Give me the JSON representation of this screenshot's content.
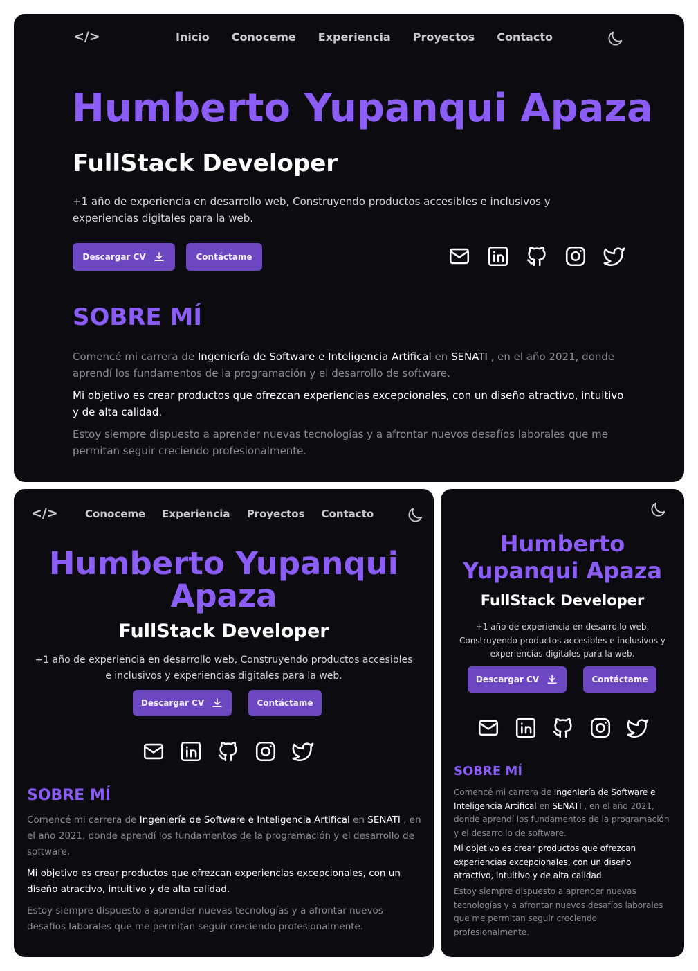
{
  "nav": {
    "logo": "</>",
    "links": [
      "Inicio",
      "Conoceme",
      "Experiencia",
      "Proyectos",
      "Contacto"
    ]
  },
  "hero": {
    "name": "Humberto Yupanqui Apaza",
    "name_line1": "Humberto Yupanqui",
    "name_line2": "Apaza",
    "name_m_line1": "Humberto",
    "name_m_line2": "Yupanqui Apaza",
    "role": "FullStack Developer",
    "intro": "+1 año de experiencia en desarrollo web, Construyendo productos accesibles e inclusivos y experiencias digitales para la web.",
    "download_label": "Descargar CV",
    "contact_label": "Contáctame"
  },
  "socials": [
    "mail-icon",
    "linkedin-icon",
    "github-icon",
    "instagram-icon",
    "twitter-icon"
  ],
  "about": {
    "title": "SOBRE MÍ",
    "p1_a": "Comencé mi carrera de ",
    "p1_b": "Ingeniería de Software e Inteligencia Artifical",
    "p1_c": " en ",
    "p1_d": "SENATI",
    "p1_e": " , en el año 2021, donde aprendí los fundamentos de la programación y el desarrollo de software.",
    "p2": "Mi objetivo es crear productos que ofrezcan experiencias excepcionales, con un diseño atractivo, intuitivo y de alta calidad.",
    "p3": "Estoy siempre dispuesto a aprender nuevas tecnologías y a afrontar nuevos desafíos laborales que me permitan seguir creciendo profesionalmente."
  },
  "colors": {
    "background": "#0b0b10",
    "accent": "#8b5cf6",
    "button": "#6d46c1"
  }
}
